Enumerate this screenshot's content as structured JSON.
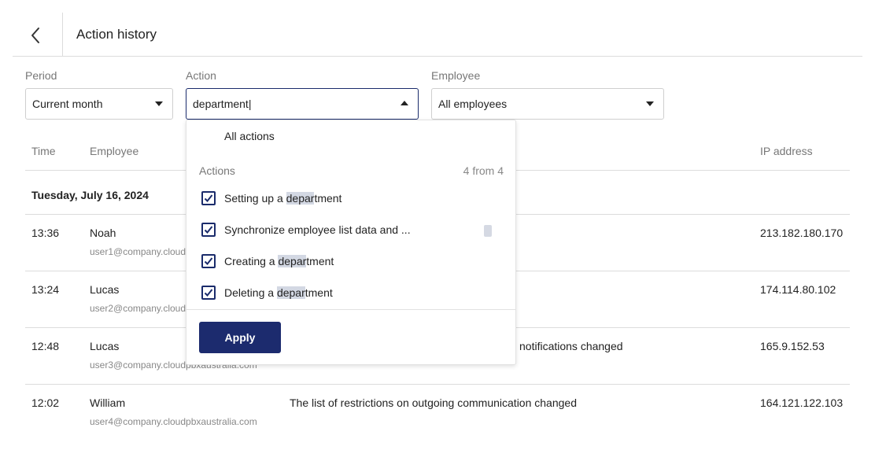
{
  "header": {
    "title": "Action history"
  },
  "filters": {
    "period": {
      "label": "Period",
      "value": "Current month"
    },
    "action": {
      "label": "Action",
      "value": "department|"
    },
    "employee": {
      "label": "Employee",
      "value": "All employees"
    }
  },
  "table": {
    "columns": {
      "time": "Time",
      "employee": "Employee",
      "ip": "IP address"
    },
    "date": "Tuesday, July 16, 2024",
    "rows": [
      {
        "time": "13:36",
        "name": "Noah",
        "email": "user1@company.cloud",
        "action": "",
        "ip": "213.182.180.170"
      },
      {
        "time": "13:24",
        "name": "Lucas",
        "email": "user2@company.cloud",
        "action": "",
        "ip": "174.114.80.102"
      },
      {
        "time": "12:48",
        "name": "Lucas",
        "email": "user3@company.cloudpbxaustralia.com",
        "action": "notifications changed",
        "ip": "165.9.152.53"
      },
      {
        "time": "12:02",
        "name": "William",
        "email": "user4@company.cloudpbxaustralia.com",
        "action": "The list of restrictions on outgoing communication changed",
        "ip": "164.121.122.103"
      }
    ]
  },
  "dropdown": {
    "all_label": "All actions",
    "section_label": "Actions",
    "count_label": "4 from 4",
    "items": [
      {
        "pre": "Setting up a ",
        "hl": "depar",
        "post": "tment",
        "checked": true
      },
      {
        "pre": "Synchronize employee list data and ...",
        "hl": "",
        "post": "",
        "checked": true
      },
      {
        "pre": "Creating a ",
        "hl": "depar",
        "post": "tment",
        "checked": true
      },
      {
        "pre": "Deleting a ",
        "hl": "depar",
        "post": "tment",
        "checked": true
      }
    ],
    "apply_label": "Apply"
  },
  "colors": {
    "accent": "#1c2b6e",
    "highlight": "#d3d8e3",
    "border": "#dcdcdc"
  },
  "icons": {
    "back": "chevron-left-icon",
    "check": "checkmark-icon",
    "caret": "caret-down-icon"
  }
}
